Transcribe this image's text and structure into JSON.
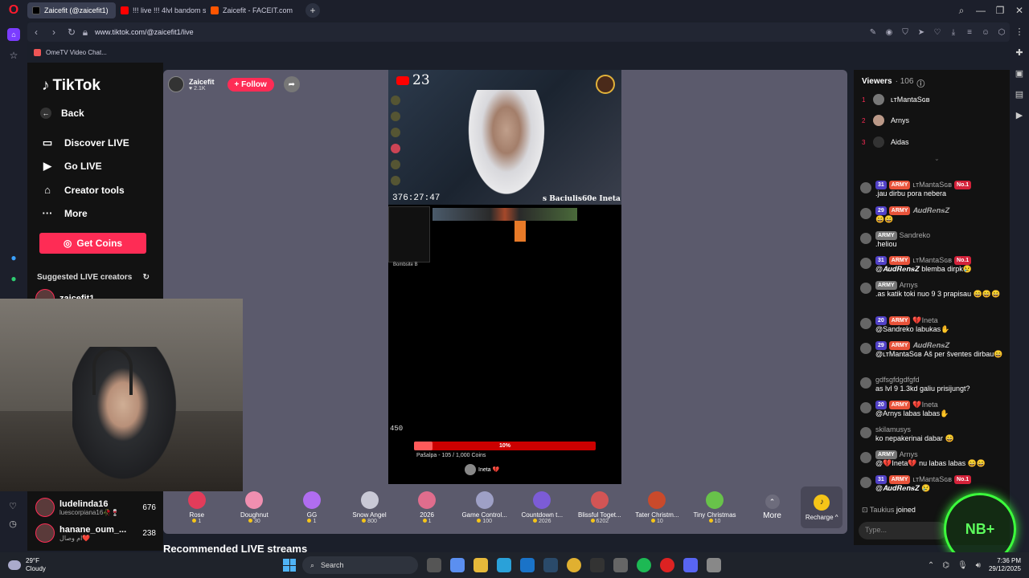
{
  "browser": {
    "tabs": [
      {
        "label": "Zaicefit (@zaicefit1) ",
        "active": true,
        "favicon_color": "#000000"
      },
      {
        "label": "!!! live !!! 4lvl bandom solo",
        "active": false,
        "favicon_color": "#ff0000"
      },
      {
        "label": "Zaicefit - FACEIT.com",
        "active": false,
        "favicon_color": "#ff5500"
      }
    ],
    "url": "www.tiktok.com/@zaicefit1/live",
    "bookmark": "OmeTV Video Chat..."
  },
  "sidebar": {
    "logo": "TikTok",
    "items": [
      {
        "label": "Back",
        "icon": "back-arrow-icon"
      },
      {
        "label": "Discover LIVE",
        "icon": "live-screen-icon"
      },
      {
        "label": "Go LIVE",
        "icon": "camera-icon"
      },
      {
        "label": "Creator tools",
        "icon": "home-icon"
      },
      {
        "label": "More",
        "icon": "more-dots-icon"
      }
    ],
    "coins_button": "Get Coins",
    "suggested_title": "Suggested LIVE creators",
    "creators": [
      {
        "name": "zaicefit1",
        "sub": "",
        "count": ""
      },
      {
        "name": "ludelinda16",
        "sub": "luescorpiana16🥀🍷",
        "count": "676"
      },
      {
        "name": "hanane_oum_...",
        "sub": "ام وصال❤️",
        "count": "238"
      }
    ]
  },
  "stream": {
    "host_name": "Zaicefit",
    "host_likes": "2.1K",
    "follow_label": "+ Follow",
    "yt_count": "23",
    "timer": "376:27:47",
    "ticker": "s Baciulis60e  Ineta I",
    "hud_label": "Bombsite B",
    "counter": "450",
    "goal_percent": "10%",
    "goal_progress": 0.1,
    "goal_text": "Pašalpa - 105 / 1,000 Coins",
    "top_gifter": "Ineta 💔"
  },
  "gifts": [
    {
      "name": "Rose",
      "price": "1",
      "color": "#e23c5a"
    },
    {
      "name": "Doughnut",
      "price": "30",
      "color": "#f08fb0"
    },
    {
      "name": "GG",
      "price": "1",
      "color": "#b06df0"
    },
    {
      "name": "Snow Angel",
      "price": "800",
      "color": "#c9c9d6"
    },
    {
      "name": "2026",
      "price": "1",
      "color": "#e06d8d"
    },
    {
      "name": "Game Control...",
      "price": "100",
      "color": "#9ea0c6"
    },
    {
      "name": "Countdown t...",
      "price": "2026",
      "color": "#7c5cd6"
    },
    {
      "name": "Blissful Toget...",
      "price": "6202",
      "color": "#d25555"
    },
    {
      "name": "Tater Christm...",
      "price": "10",
      "color": "#c94a2b"
    },
    {
      "name": "Tiny Christmas",
      "price": "10",
      "color": "#68c24a"
    }
  ],
  "more_label": "More",
  "recharge_label": "Recharge ^",
  "recommended": "Recommended LIVE streams",
  "chat": {
    "viewers_title": "Viewers",
    "viewers_count": "· 106",
    "top_viewers": [
      {
        "rank": "1",
        "name": "ʟᴛMantaSɢв"
      },
      {
        "rank": "2",
        "name": "Arnys"
      },
      {
        "rank": "3",
        "name": "Aidas"
      }
    ],
    "messages": [
      {
        "level": "31",
        "army": "ARMY",
        "user": "ʟᴛMantaSɢв",
        "no1": "No.1",
        "text": ".jau dirbu pora nebera"
      },
      {
        "level": "29",
        "army": "ARMY",
        "user": "𝑨𝒖𝒅𝑹𝒆𝒏𝒔𝒁",
        "no1": "",
        "text": "😄😄"
      },
      {
        "level": "",
        "army": "ARMY",
        "user": "Sandreko",
        "no1": "",
        "text": ".heliou"
      },
      {
        "level": "31",
        "army": "ARMY",
        "user": "ʟᴛMantaSɢв",
        "no1": "No.1",
        "text": "@𝑨𝒖𝒅𝑹𝒆𝒏𝒔𝒁 blemba dirpk😢"
      },
      {
        "level": "",
        "army": "ARMY",
        "user": "Arnys",
        "no1": "",
        "text": ".as katik toki nuo 9 3 prapisau 😄😄😄"
      },
      {
        "level": "20",
        "army": "ARMY",
        "user": "💔Ineta",
        "no1": "",
        "text": "@Sandreko labukas✋"
      },
      {
        "level": "29",
        "army": "ARMY",
        "user": "𝑨𝒖𝒅𝑹𝒆𝒏𝒔𝒁",
        "no1": "",
        "text": "@ʟᴛMantaSɢв Aš per šventes dirbau😄"
      },
      {
        "level": "",
        "army": "",
        "user": "gdfsgfdgdfgfd",
        "no1": "",
        "text": "as lvl 9 1.3kd galiu prisijungt?"
      },
      {
        "level": "20",
        "army": "ARMY",
        "user": "💔Ineta",
        "no1": "",
        "text": "@Arnys labas labas✋"
      },
      {
        "level": "",
        "army": "",
        "user": "skilamusys",
        "no1": "",
        "text": "ko nepakerinai dabar 😄"
      },
      {
        "level": "",
        "army": "ARMY",
        "user": "Arnys",
        "no1": "",
        "text": "@💔Ineta💔 nu labas labas 😄😄"
      },
      {
        "level": "31",
        "army": "ARMY",
        "user": "ʟᴛMantaSɢв",
        "no1": "No.1",
        "text": "@𝑨𝒖𝒅𝑹𝒆𝒏𝒔𝒁 😢"
      }
    ],
    "joined_user": "Taukius",
    "joined_text": "joined",
    "type_placeholder": "Type..."
  },
  "overlay_badge": "NB+",
  "taskbar": {
    "temp": "29°F",
    "weather": "Cloudy",
    "search": "Search",
    "time": "7:36 PM",
    "date": "29/12/2025"
  }
}
